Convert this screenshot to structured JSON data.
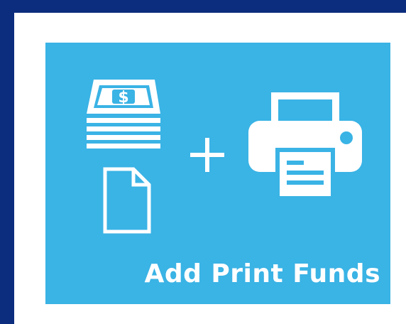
{
  "tile": {
    "label": "Add Print Funds",
    "background": "#3ab3e5",
    "accent": "#ffffff"
  },
  "page": {
    "border_color": "#0c2d7e",
    "frame_color": "#ffffff"
  },
  "icons": [
    "money-stack-icon",
    "document-icon",
    "plus-icon",
    "printer-icon"
  ]
}
